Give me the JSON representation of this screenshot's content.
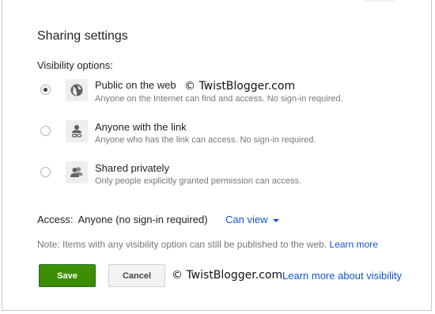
{
  "dialog": {
    "title": "Sharing settings",
    "visibility_label": "Visibility options:",
    "options": [
      {
        "title": "Public on the web",
        "description": "Anyone on the Internet can find and access. No sign-in required.",
        "icon": "globe-icon",
        "selected": true
      },
      {
        "title": "Anyone with the link",
        "description": "Anyone who has the link can access. No sign-in required.",
        "icon": "link-user-icon",
        "selected": false
      },
      {
        "title": "Shared privately",
        "description": "Only people explicitly granted permission can access.",
        "icon": "people-icon",
        "selected": false
      }
    ],
    "access": {
      "label": "Access:",
      "value": "Anyone (no sign-in required)",
      "permission": "Can view"
    },
    "note": {
      "text": "Note: Items with any visibility option can still be published to the web.",
      "link": "Learn more"
    },
    "buttons": {
      "save": "Save",
      "cancel": "Cancel"
    },
    "learn_more_visibility": "Learn more about visibility"
  },
  "watermarks": {
    "top": "© TwistBlogger.com",
    "bottom": "© TwistBlogger.com"
  },
  "colors": {
    "link": "#1155cc",
    "save_button": "#3d9400",
    "secondary_text": "#777777"
  }
}
